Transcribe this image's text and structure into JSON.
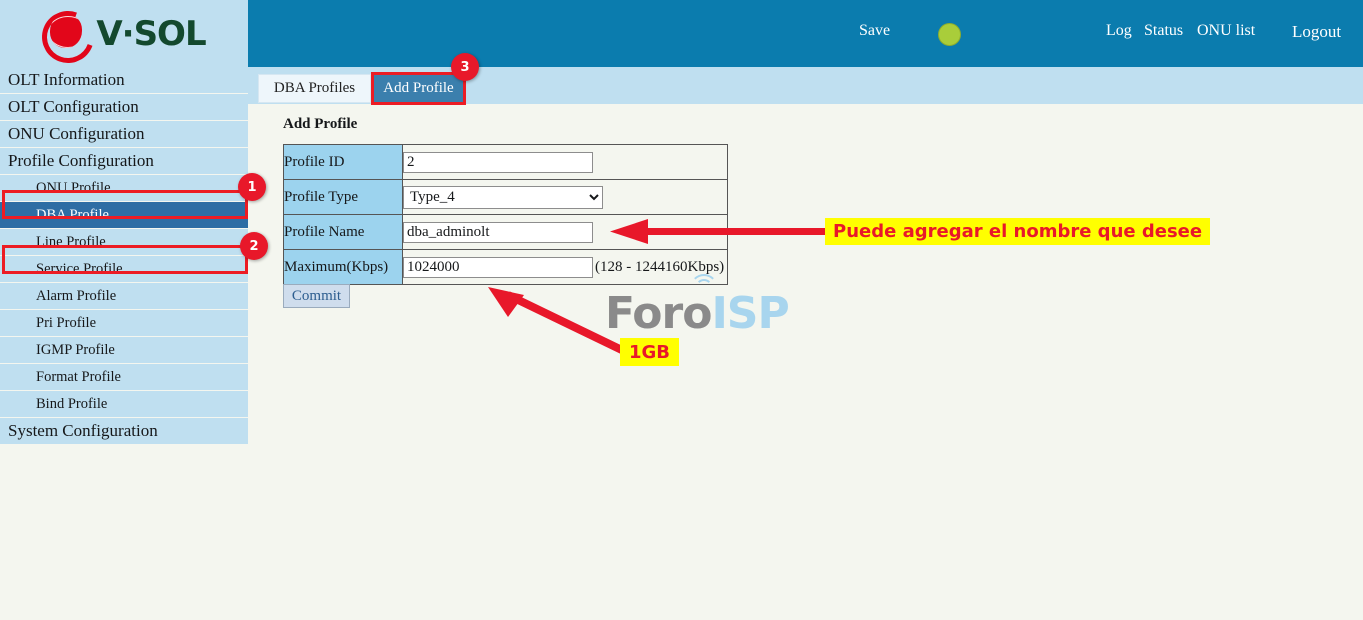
{
  "brand": {
    "logo_text": "V·SOL",
    "logo_mark": "vsol-droplet-icon"
  },
  "topbar": {
    "save": "Save",
    "status_indicator": "green-status-dot",
    "log": "Log",
    "status": "Status",
    "onu_list": "ONU list",
    "logout": "Logout"
  },
  "tabs": [
    {
      "label": "DBA Profiles",
      "active": false
    },
    {
      "label": "Add Profile",
      "active": true
    }
  ],
  "sidebar": {
    "items": [
      {
        "label": "OLT Information",
        "level": "top",
        "selected": false
      },
      {
        "label": "OLT Configuration",
        "level": "top",
        "selected": false
      },
      {
        "label": "ONU Configuration",
        "level": "top",
        "selected": false
      },
      {
        "label": "Profile Configuration",
        "level": "top",
        "selected": false
      },
      {
        "label": "ONU Profile",
        "level": "sub",
        "selected": false
      },
      {
        "label": "DBA Profile",
        "level": "sub",
        "selected": true
      },
      {
        "label": "Line Profile",
        "level": "sub",
        "selected": false
      },
      {
        "label": "Service Profile",
        "level": "sub",
        "selected": false
      },
      {
        "label": "Alarm Profile",
        "level": "sub",
        "selected": false
      },
      {
        "label": "Pri Profile",
        "level": "sub",
        "selected": false
      },
      {
        "label": "IGMP Profile",
        "level": "sub",
        "selected": false
      },
      {
        "label": "Format Profile",
        "level": "sub",
        "selected": false
      },
      {
        "label": "Bind Profile",
        "level": "sub",
        "selected": false
      },
      {
        "label": "System Configuration",
        "level": "top",
        "selected": false
      }
    ]
  },
  "main": {
    "heading": "Add Profile",
    "form": {
      "profile_id": {
        "label": "Profile ID",
        "value": "2"
      },
      "profile_type": {
        "label": "Profile Type",
        "value": "Type_4"
      },
      "profile_name": {
        "label": "Profile Name",
        "value": "dba_adminolt"
      },
      "maximum": {
        "label": "Maximum(Kbps)",
        "value": "1024000",
        "hint": "(128 - 1244160Kbps)"
      }
    },
    "commit_label": "Commit"
  },
  "watermark": {
    "part1": "Foro",
    "part2": "ISP"
  },
  "annotations": {
    "badge_1": "1",
    "badge_2": "2",
    "badge_3": "3",
    "name_note": "Puede agregar el nombre que desee",
    "size_note": "1GB",
    "accent_red": "#e8182a",
    "highlight_yellow": "#ffff00"
  }
}
